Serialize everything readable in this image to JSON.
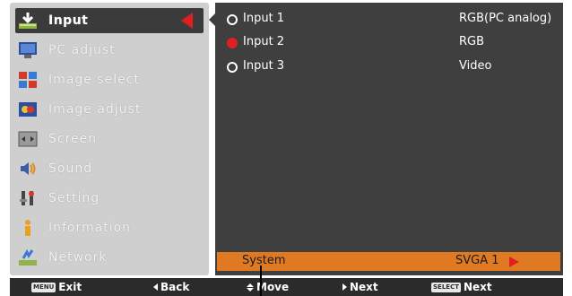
{
  "menu": {
    "items": [
      {
        "label": "Input",
        "icon": "input-icon",
        "active": true
      },
      {
        "label": "PC adjust",
        "icon": "pc-adjust-icon"
      },
      {
        "label": "Image select",
        "icon": "image-select-icon"
      },
      {
        "label": "Image adjust",
        "icon": "image-adjust-icon"
      },
      {
        "label": "Screen",
        "icon": "screen-icon"
      },
      {
        "label": "Sound",
        "icon": "sound-icon"
      },
      {
        "label": "Setting",
        "icon": "setting-icon"
      },
      {
        "label": "Information",
        "icon": "information-icon"
      },
      {
        "label": "Network",
        "icon": "network-icon"
      }
    ]
  },
  "inputs": [
    {
      "name": "Input 1",
      "signal": "RGB(PC analog)",
      "selected": false
    },
    {
      "name": "Input 2",
      "signal": "RGB",
      "selected": true
    },
    {
      "name": "Input 3",
      "signal": "Video",
      "selected": false
    }
  ],
  "system": {
    "label": "System",
    "value": "SVGA 1"
  },
  "guide": {
    "exit": {
      "key": "MENU",
      "label": "Exit"
    },
    "back": {
      "label": "Back"
    },
    "move": {
      "label": "Move"
    },
    "next": {
      "label": "Next"
    },
    "select_next": {
      "key": "SELECT",
      "label": "Next"
    }
  },
  "colors": {
    "accent_red": "#e02020",
    "highlight_orange": "#e07a22",
    "panel_dark": "#3f3f3f",
    "menu_grey": "#cfcfcf"
  }
}
